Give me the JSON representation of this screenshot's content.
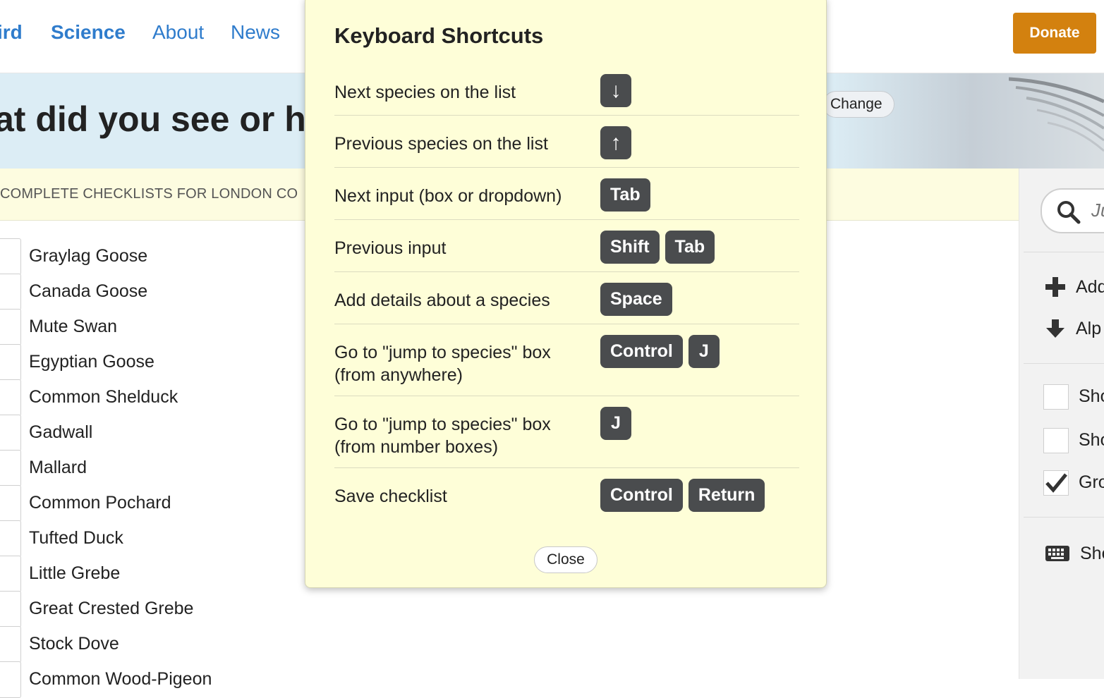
{
  "nav": {
    "brand_fragment": "ird",
    "links": [
      "Science",
      "About",
      "News"
    ],
    "donate": "Donate"
  },
  "hero": {
    "title_fragment": "at did you see or h",
    "change": "Change"
  },
  "info": {
    "text": "COMPLETE CHECKLISTS FOR LONDON CO"
  },
  "species": [
    "Graylag Goose",
    "Canada Goose",
    "Mute Swan",
    "Egyptian Goose",
    "Common Shelduck",
    "Gadwall",
    "Mallard",
    "Common Pochard",
    "Tufted Duck",
    "Little Grebe",
    "Great Crested Grebe",
    "Stock Dove",
    "Common Wood-Pigeon"
  ],
  "sidebar": {
    "search_placeholder": "Ju",
    "add_label": "Add",
    "alpha_label": "Alp",
    "checks": [
      {
        "label": "Sho",
        "checked": false
      },
      {
        "label": "Sho",
        "checked": false
      },
      {
        "label": "Gro",
        "checked": true
      }
    ],
    "shortcuts_label": "Sho"
  },
  "modal": {
    "title": "Keyboard Shortcuts",
    "shortcuts": [
      {
        "label": "Next species on the list",
        "keys": [
          "↓"
        ]
      },
      {
        "label": "Previous species on the list",
        "keys": [
          "↑"
        ]
      },
      {
        "label": "Next input (box or dropdown)",
        "keys": [
          "Tab"
        ]
      },
      {
        "label": "Previous input",
        "keys": [
          "Shift",
          "Tab"
        ]
      },
      {
        "label": "Add details about a species",
        "keys": [
          "Space"
        ]
      },
      {
        "label": "Go to \"jump to species\" box (from anywhere)",
        "keys": [
          "Control",
          "J"
        ]
      },
      {
        "label": "Go to \"jump to species\" box (from number boxes)",
        "keys": [
          "J"
        ]
      },
      {
        "label": "Save checklist",
        "keys": [
          "Control",
          "Return"
        ]
      }
    ],
    "close": "Close"
  },
  "colors": {
    "link": "#2f7ccc",
    "donate": "#d3810f",
    "modal_bg": "#fefed8",
    "key_bg": "#4a4c4e",
    "hero_bg": "#dcedf5",
    "info_bg": "#fdfce0"
  }
}
